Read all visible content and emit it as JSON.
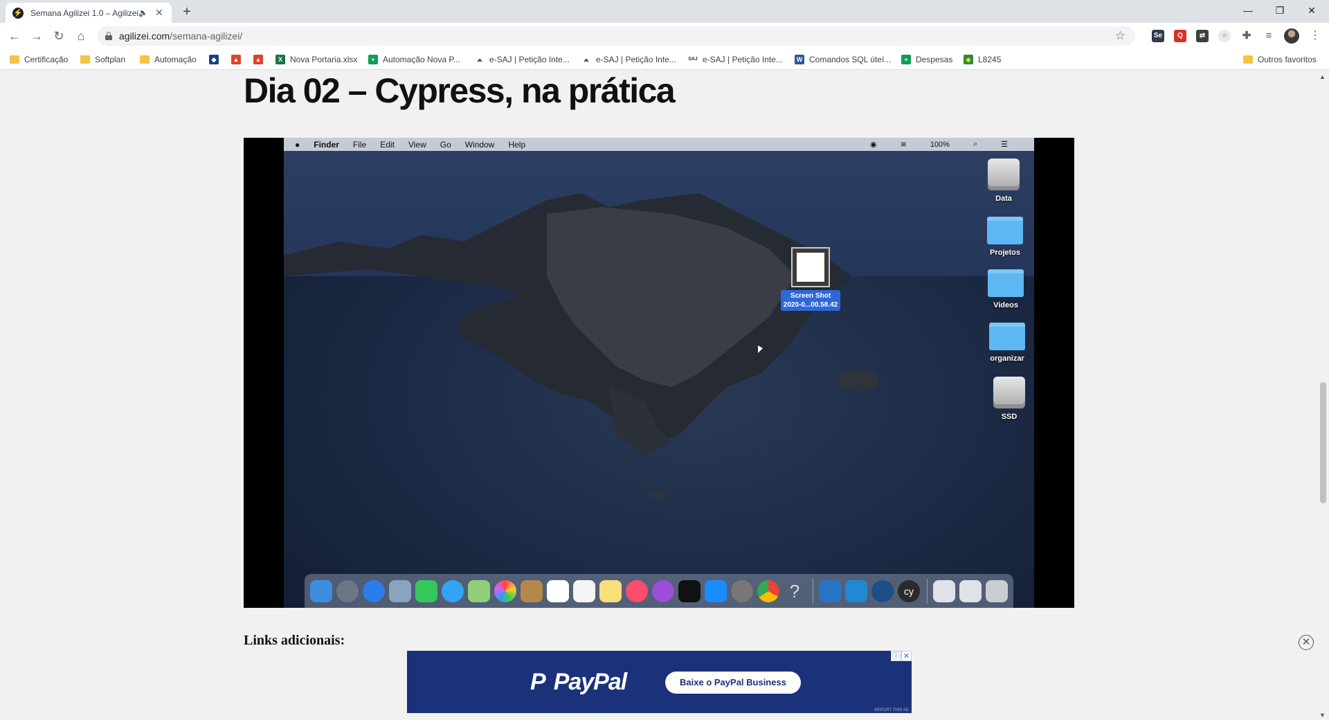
{
  "browser": {
    "tab": {
      "title": "Semana Agilizei 1.0 – Agilizei",
      "audio_icon": "speaker-icon",
      "close": "✕"
    },
    "new_tab": "+",
    "window_controls": [
      "—",
      "❐",
      "✕"
    ],
    "url": {
      "domain": "agilizei.com",
      "path": "/semana-agilizei/"
    },
    "bookmarks": [
      {
        "label": "Certificação",
        "icon": "folder-icon"
      },
      {
        "label": "Softplan",
        "icon": "folder-icon"
      },
      {
        "label": "Automação",
        "icon": "folder-icon"
      },
      {
        "label": "Nova Portaria.xlsx",
        "icon": "excel-icon"
      },
      {
        "label": "Automação Nova P...",
        "icon": "sheets-icon"
      },
      {
        "label": "e-SAJ | Petição Inte...",
        "icon": "esaj-icon"
      },
      {
        "label": "e-SAJ | Petição Inte...",
        "icon": "esaj-icon"
      },
      {
        "label": "e-SAJ | Petição Inte...",
        "icon": "saj-icon"
      },
      {
        "label": "Comandos SQL úteí...",
        "icon": "word-icon"
      },
      {
        "label": "Despesas",
        "icon": "sheets-icon"
      },
      {
        "label": "L8245",
        "icon": "flag-icon"
      },
      {
        "label": "Outros favoritos",
        "icon": "folder-icon"
      }
    ]
  },
  "page": {
    "title": "Dia 02 – Cypress, na prática",
    "links_heading": "Links adicionais:"
  },
  "video": {
    "menubar": [
      "Finder",
      "File",
      "Edit",
      "View",
      "Go",
      "Window",
      "Help"
    ],
    "status": {
      "battery": "100%"
    },
    "desktop_icons": [
      "Data",
      "Projetos",
      "Videos",
      "organizar",
      "SSD"
    ],
    "selected_file": {
      "line1": "Screen Shot",
      "line2": "2020-0...00.58.42"
    }
  },
  "ad": {
    "brand": "PayPal",
    "cta": "Baixe o PayPal Business",
    "badge_info": "ⓘ",
    "badge_close": "✕",
    "footer": "REPORT THIS AD"
  },
  "ad_close": "✕",
  "colors": {
    "ad_bg": "#1b3179",
    "chrome_tabstrip": "#dee1e6",
    "page_bg": "#f1f1f1"
  }
}
